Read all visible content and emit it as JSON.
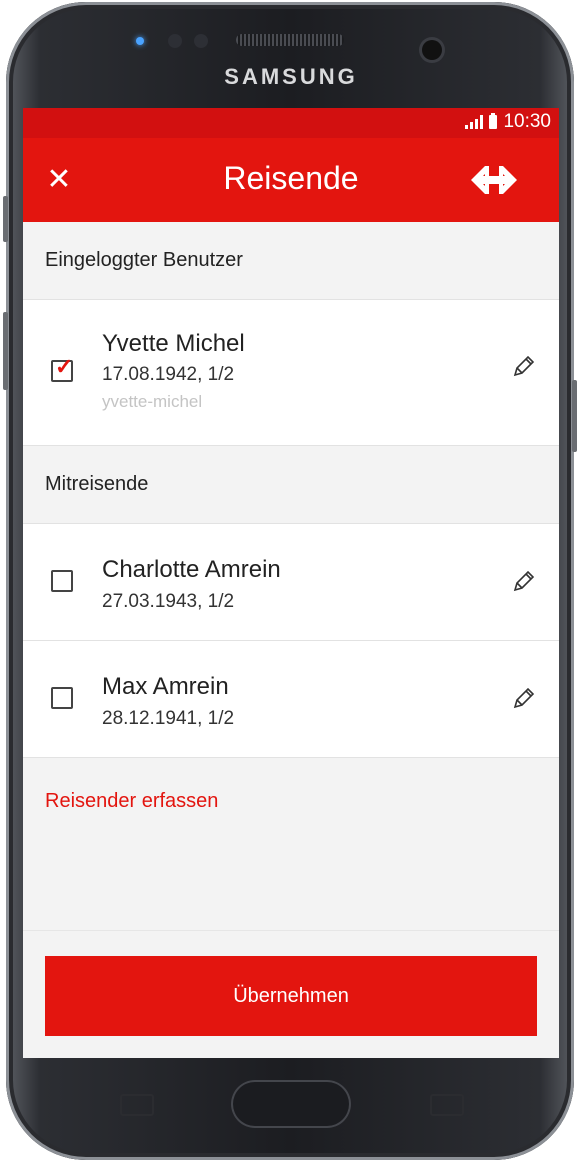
{
  "device": {
    "brand": "SAMSUNG"
  },
  "status_bar": {
    "time": "10:30"
  },
  "app_bar": {
    "title": "Reisende",
    "close_icon": "close-icon",
    "logo": "sbb-logo"
  },
  "logged_in_section": {
    "header": "Eingeloggter Benutzer",
    "user": {
      "name": "Yvette Michel",
      "details": "17.08.1942, 1/2",
      "username": "yvette-michel",
      "checked": true
    }
  },
  "companions_section": {
    "header": "Mitreisende",
    "travelers": [
      {
        "name": "Charlotte Amrein",
        "details": "27.03.1943, 1/2",
        "checked": false
      },
      {
        "name": "Max Amrein",
        "details": "28.12.1941, 1/2",
        "checked": false
      }
    ]
  },
  "add_traveler_link": "Reisender erfassen",
  "accept_button": "Übernehmen",
  "colors": {
    "accent": "#e3150f",
    "status_bar": "#d21010",
    "background": "#f3f3f3"
  }
}
